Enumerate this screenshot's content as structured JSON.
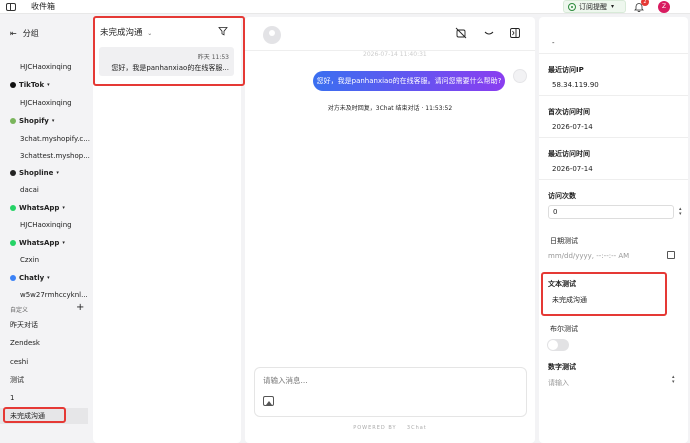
{
  "topbar": {
    "title": "收件箱",
    "subscribe_label": "订阅提醒",
    "notif_count": "2",
    "avatar_letter": "Z"
  },
  "sidebar": {
    "group_title": "分组",
    "rows": [
      {
        "kind": "sub",
        "label": "HJCHaoxinqing"
      },
      {
        "kind": "channel",
        "label": "TikTok",
        "icon": "tiktok-icon",
        "color": "#111111"
      },
      {
        "kind": "sub",
        "label": "HJCHaoxinqing"
      },
      {
        "kind": "channel",
        "label": "Shopify",
        "icon": "shopify-icon",
        "color": "#7ab55c"
      },
      {
        "kind": "sub",
        "label": "3chat.myshopify.c..."
      },
      {
        "kind": "sub",
        "label": "3chattest.myshop..."
      },
      {
        "kind": "channel",
        "label": "Shopline",
        "icon": "shopline-icon",
        "color": "#222222"
      },
      {
        "kind": "sub",
        "label": "dacai"
      },
      {
        "kind": "channel",
        "label": "WhatsApp",
        "icon": "whatsapp-icon",
        "color": "#25d366"
      },
      {
        "kind": "sub",
        "label": "HJCHaoxinqing"
      },
      {
        "kind": "channel",
        "label": "WhatsApp",
        "icon": "whatsapp-icon",
        "color": "#25d366"
      },
      {
        "kind": "sub",
        "label": "Czxin"
      },
      {
        "kind": "channel",
        "label": "Chatly",
        "icon": "chatly-icon",
        "color": "#3b82f6"
      },
      {
        "kind": "sub",
        "label": "w5w27rmhccyknl..."
      }
    ],
    "custom_label": "自定义",
    "custom_views": [
      "昨天对话",
      "Zendesk",
      "ceshi",
      "测试",
      "1",
      "未完成沟通"
    ]
  },
  "conv_list": {
    "title": "未完成沟通",
    "item": {
      "time": "昨天 11:53",
      "preview": "您好，我是panhanxiao的在线客服..."
    }
  },
  "chat": {
    "faint_timestamp": "2026-07-14 11:40:31",
    "message": "您好，我是panhanxiao的在线客服。请问您需要什么帮助?",
    "system_note": "对方未及时回复，3Chat 结束对话 · 11:53:52",
    "input_placeholder": "请输入消息...",
    "powered_by": "POWERED BY",
    "brand": "3Chat"
  },
  "details": {
    "top_value": "-",
    "last_ip_label": "最近访问IP",
    "last_ip": "58.34.119.90",
    "first_visit_label": "首次访问时间",
    "first_visit": "2026-07-14",
    "last_visit_label": "最近访问时间",
    "last_visit": "2026-07-14",
    "visit_count_label": "访问次数",
    "visit_count": "0",
    "date_test_label": "日期测试",
    "date_test_placeholder": "mm/dd/yyyy, --:--:-- AM",
    "text_test_label": "文本测试",
    "text_test_value": "未完成沟通",
    "bool_test_label": "布尔测试",
    "number_test_label": "数字测试",
    "number_test_placeholder": "请输入"
  },
  "colors": {
    "highlight": "#e53935",
    "bubble_start": "#3a6ff0",
    "bubble_end": "#8a3df0"
  }
}
